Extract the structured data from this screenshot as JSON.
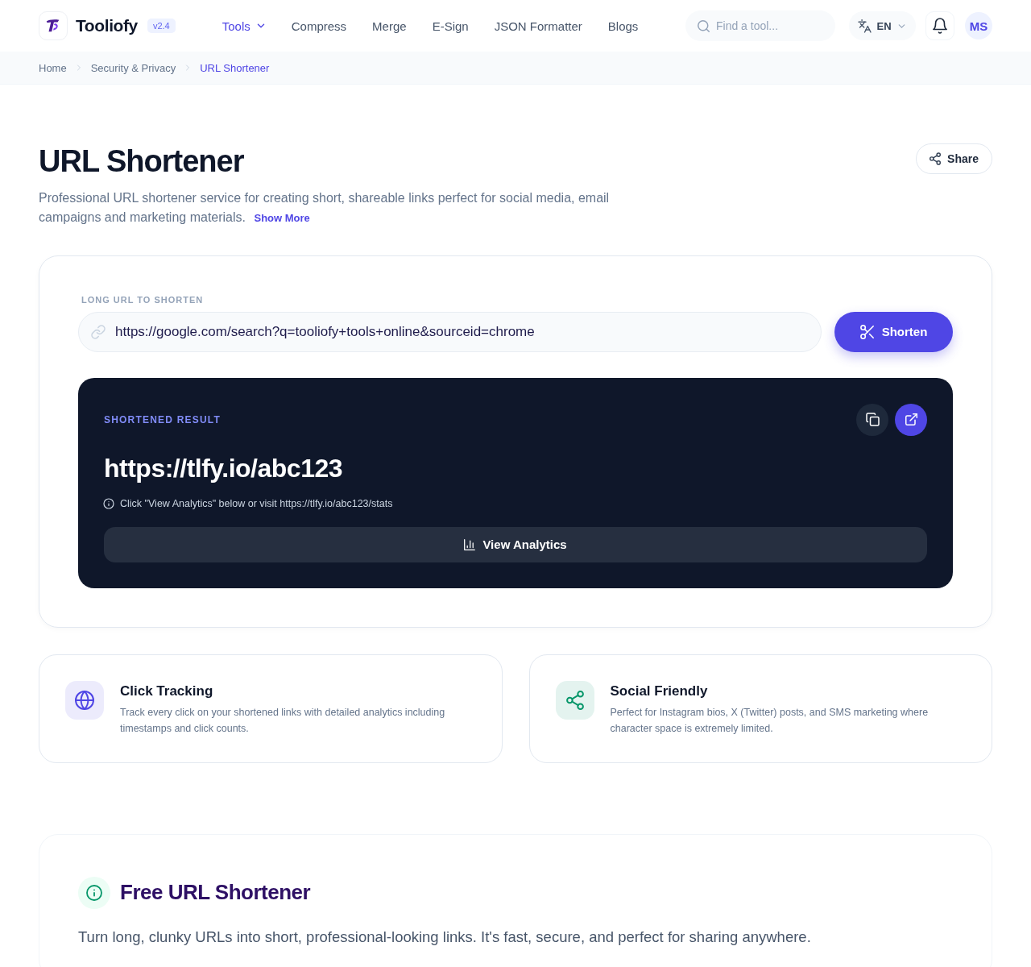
{
  "header": {
    "brand": {
      "name": "Tooliofy",
      "version": "v2.4"
    },
    "nav": [
      {
        "label": "Tools",
        "kind": "menu",
        "selected": true
      },
      {
        "label": "Compress",
        "kind": "link",
        "selected": false
      },
      {
        "label": "Merge",
        "kind": "link",
        "selected": false
      },
      {
        "label": "E-Sign",
        "kind": "link",
        "selected": false
      },
      {
        "label": "JSON Formatter",
        "kind": "link",
        "selected": false
      },
      {
        "label": "Blogs",
        "kind": "link",
        "selected": false
      }
    ],
    "search": {
      "placeholder": "Find a tool..."
    },
    "language": {
      "code": "EN"
    },
    "avatar": {
      "initials": "MS"
    }
  },
  "breadcrumb": [
    {
      "label": "Home",
      "current": false
    },
    {
      "label": "Security & Privacy",
      "current": false
    },
    {
      "label": "URL Shortener",
      "current": true
    }
  ],
  "page": {
    "title": "URL Shortener",
    "description": "Professional URL shortener service for creating short, shareable links perfect for social media, email campaigns and marketing materials.",
    "more_link": "Show More",
    "share_button": "Share"
  },
  "shortener": {
    "label": "LONG URL TO SHORTEN",
    "input": {
      "value": "https://google.com/search?q=tooliofy+tools+online&sourceid=chrome"
    },
    "button": "Shorten",
    "result": {
      "label": "SHORTENED RESULT",
      "url": "https://tlfy.io/abc123",
      "hint": "Click \"View Analytics\" below or visit https://tlfy.io/abc123/stats",
      "analytics_button": "View Analytics"
    }
  },
  "features": [
    {
      "title": "Click Tracking",
      "description": "Track every click on your shortened links with detailed analytics including timestamps and click counts.",
      "color": "#4f46e5"
    },
    {
      "title": "Social Friendly",
      "description": "Perfect for Instagram bios, X (Twitter) posts, and SMS marketing where character space is extremely limited.",
      "color": "#059669"
    }
  ],
  "about": {
    "title": "Free URL Shortener",
    "text": "Turn long, clunky URLs into short, professional-looking links. It's fast, secure, and perfect for sharing anywhere."
  }
}
